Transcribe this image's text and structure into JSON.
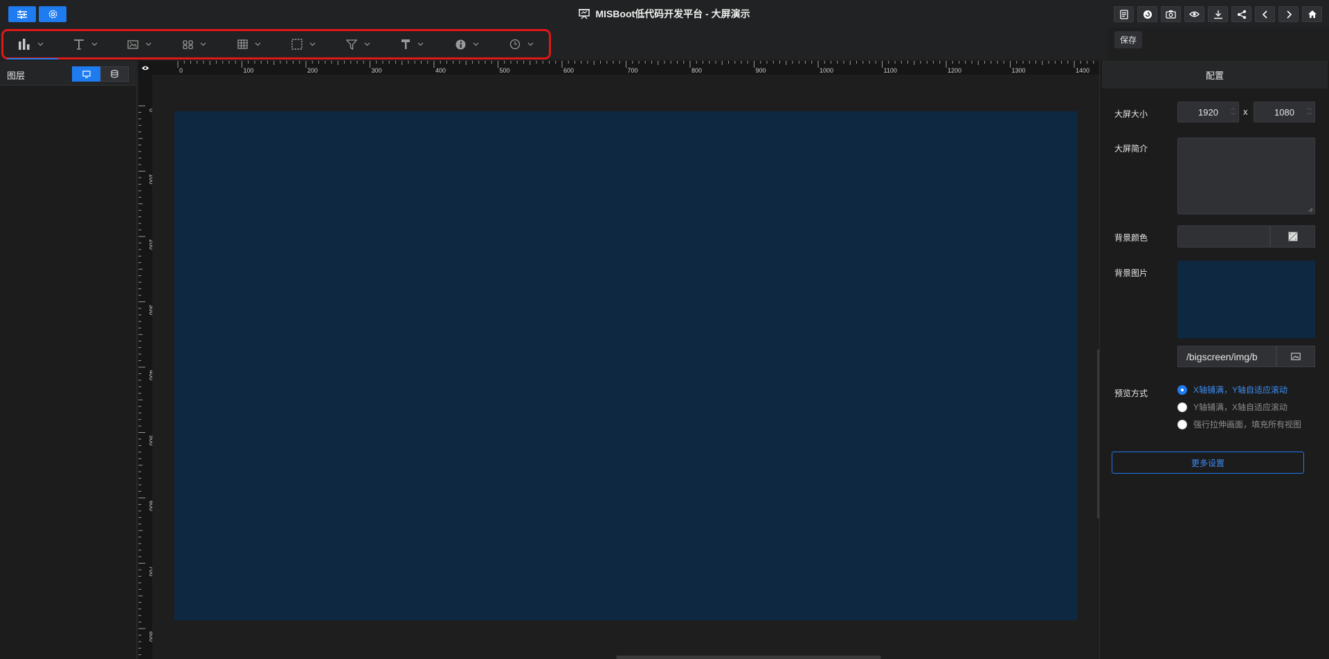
{
  "header": {
    "title": "MISBoot低代码开发平台 - 大屏演示",
    "left_buttons": [
      "settings-sliders-icon",
      "gear-icon"
    ],
    "right_buttons": [
      "save-icon",
      "refresh-icon",
      "camera-icon",
      "eye-icon",
      "download-icon",
      "share-icon",
      "chevron-left-icon",
      "chevron-right-icon",
      "home-icon"
    ],
    "tooltip": "保存"
  },
  "toolbar": {
    "tools": [
      {
        "name": "bar-chart-icon",
        "active": true
      },
      {
        "name": "text-icon",
        "active": false
      },
      {
        "name": "image-icon",
        "active": false
      },
      {
        "name": "grid-blocks-icon",
        "active": false
      },
      {
        "name": "table-icon",
        "active": false
      },
      {
        "name": "border-frame-icon",
        "active": false
      },
      {
        "name": "filter-icon",
        "active": false
      },
      {
        "name": "hammer-icon",
        "active": false
      },
      {
        "name": "info-icon",
        "active": false
      },
      {
        "name": "clock-icon",
        "active": false
      }
    ]
  },
  "layers": {
    "title": "图层",
    "toggle": [
      "monitor-icon",
      "database-icon"
    ]
  },
  "ruler": {
    "h_labels": [
      "0",
      "100",
      "200",
      "300",
      "400",
      "500",
      "600",
      "700",
      "800",
      "900",
      "1000",
      "1100",
      "1200",
      "1300",
      "1400"
    ],
    "v_labels": [
      "0",
      "100",
      "200",
      "300",
      "400",
      "500",
      "600",
      "700",
      "800"
    ]
  },
  "config": {
    "title": "配置",
    "size_label": "大屏大小",
    "width": "1920",
    "height": "1080",
    "times": "x",
    "desc_label": "大屏简介",
    "desc_value": "",
    "bg_color_label": "背景颜色",
    "bg_image_label": "背景图片",
    "bg_image_path": "/bigscreen/img/b",
    "preview_label": "预览方式",
    "preview_options": [
      {
        "label": "X轴铺满，Y轴自适应滚动",
        "selected": true
      },
      {
        "label": "Y轴铺满，X轴自适应滚动",
        "selected": false
      },
      {
        "label": "强行拉伸画面，填充所有视图",
        "selected": false
      }
    ],
    "more_button": "更多设置"
  },
  "colors": {
    "accent": "#1e7bf0",
    "screen_bg": "#0e2841",
    "highlight_border": "#e01818"
  }
}
